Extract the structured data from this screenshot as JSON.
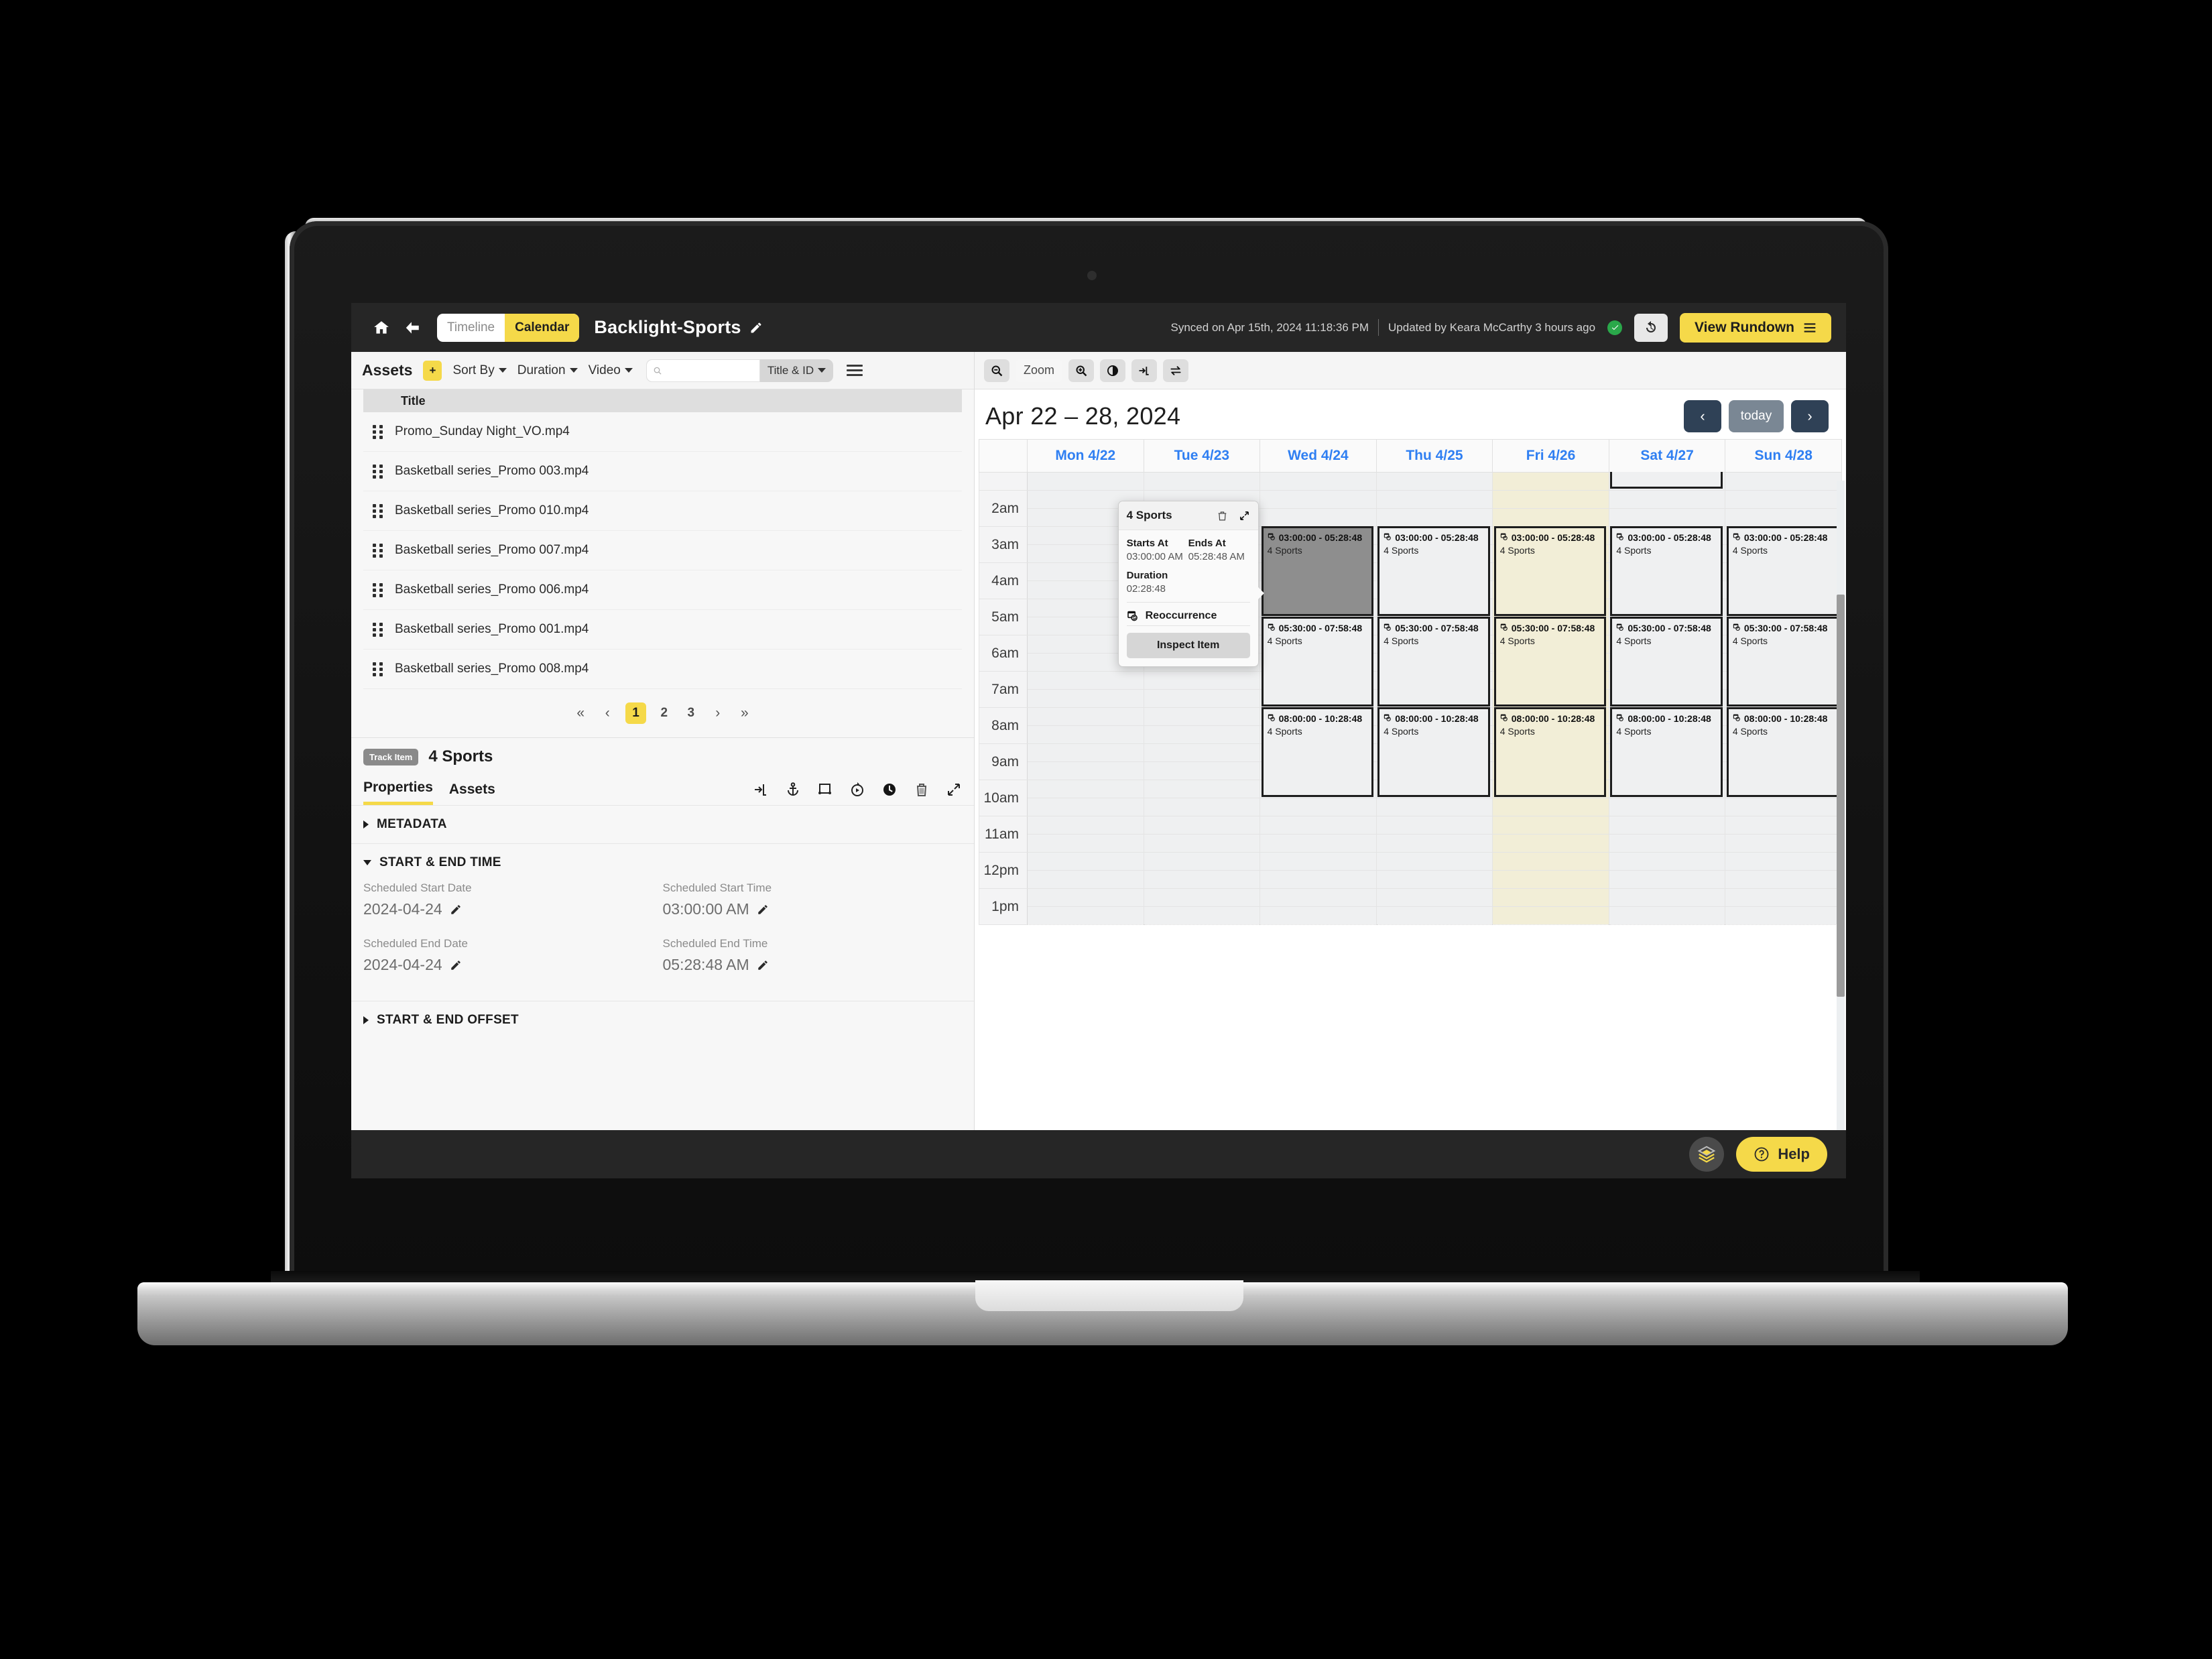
{
  "header": {
    "home_icon": "home-icon",
    "back_icon": "back-arrow-icon",
    "view_toggle": [
      {
        "label": "Timeline",
        "active": false
      },
      {
        "label": "Calendar",
        "active": true
      }
    ],
    "project_title": "Backlight-Sports",
    "edit_icon": "pencil-icon",
    "synced_text": "Synced on Apr 15th, 2024 11:18:36 PM",
    "updated_text": "Updated by Keara McCarthy 3 hours ago",
    "status_icon": "check-circle-icon",
    "status_color": "#2aa84a",
    "history_icon": "history-clock-icon",
    "rundown_label": "View Rundown",
    "rundown_icon": "list-menu-icon",
    "accent_color": "#f5d949"
  },
  "assets_toolbar": {
    "title": "Assets",
    "add_label": "+",
    "sort_by": "Sort By",
    "duration": "Duration",
    "media_type": "Video",
    "search_value": "",
    "search_placeholder": "",
    "search_scope": "Title & ID",
    "list_icon": "hamburger-icon",
    "zoom_out_icon": "zoom-out-icon",
    "zoom_label": "Zoom",
    "zoom_in_icon": "zoom-in-icon",
    "contrast_icon": "contrast-icon",
    "insert_icon": "insert-into-icon",
    "swap_icon": "swap-arrows-icon"
  },
  "asset_list": {
    "column_header": "Title",
    "rows": [
      {
        "title": "Promo_Sunday Night_VO.mp4"
      },
      {
        "title": "Basketball series_Promo 003.mp4"
      },
      {
        "title": "Basketball series_Promo 010.mp4"
      },
      {
        "title": "Basketball series_Promo 007.mp4"
      },
      {
        "title": "Basketball series_Promo 006.mp4"
      },
      {
        "title": "Basketball series_Promo 001.mp4"
      },
      {
        "title": "Basketball series_Promo 008.mp4"
      }
    ]
  },
  "pagination": {
    "first": "«",
    "prev": "‹",
    "pages": [
      "1",
      "2",
      "3"
    ],
    "current": "1",
    "next": "›",
    "last": "»"
  },
  "track_item": {
    "badge": "Track Item",
    "name": "4 Sports",
    "tabs": [
      {
        "label": "Properties",
        "active": true
      },
      {
        "label": "Assets",
        "active": false
      }
    ],
    "icons": [
      "insert-into-icon",
      "anchor-icon",
      "crop-frame-icon",
      "replay-icon",
      "clock-icon",
      "trash-icon",
      "collapse-icon"
    ],
    "sections": [
      {
        "label": "METADATA",
        "open": false
      },
      {
        "label": "START & END TIME",
        "open": true
      },
      {
        "label": "START & END OFFSET",
        "open": false
      }
    ],
    "fields": [
      {
        "label": "Scheduled Start Date",
        "value": "2024-04-24",
        "edit_icon": "pencil-icon"
      },
      {
        "label": "Scheduled Start Time",
        "value": "03:00:00 AM",
        "edit_icon": "pencil-icon"
      },
      {
        "label": "Scheduled End Date",
        "value": "2024-04-24",
        "edit_icon": "pencil-icon"
      },
      {
        "label": "Scheduled End Time",
        "value": "05:28:48 AM",
        "edit_icon": "pencil-icon"
      }
    ]
  },
  "calendar": {
    "title": "Apr 22 – 28, 2024",
    "prev_label": "‹",
    "today_label": "today",
    "next_label": "›",
    "day_headers": [
      "Mon 4/22",
      "Tue 4/23",
      "Wed 4/24",
      "Thu 4/25",
      "Fri 4/26",
      "Sat 4/27",
      "Sun 4/28"
    ],
    "highlight_day": "Fri 4/26",
    "highlight_color": "#f2eed7",
    "time_labels": [
      "2am",
      "3am",
      "4am",
      "5am",
      "6am",
      "7am",
      "8am",
      "9am",
      "10am",
      "11am",
      "12pm",
      "1pm"
    ],
    "events": [
      {
        "day": "Wed 4/24",
        "time": "03:00:00 - 05:28:48",
        "name": "4 Sports",
        "selected": true
      },
      {
        "day": "Thu 4/25",
        "time": "03:00:00 - 05:28:48",
        "name": "4 Sports",
        "selected": false
      },
      {
        "day": "Fri 4/26",
        "time": "03:00:00 - 05:28:48",
        "name": "4 Sports",
        "selected": false
      },
      {
        "day": "Sat 4/27",
        "time": "03:00:00 - 05:28:48",
        "name": "4 Sports",
        "selected": false
      },
      {
        "day": "Sun 4/28",
        "time": "03:00:00 - 05:28:48",
        "name": "4 Sports",
        "selected": false
      },
      {
        "day": "Wed 4/24",
        "time": "05:30:00 - 07:58:48",
        "name": "4 Sports",
        "selected": false
      },
      {
        "day": "Thu 4/25",
        "time": "05:30:00 - 07:58:48",
        "name": "4 Sports",
        "selected": false
      },
      {
        "day": "Fri 4/26",
        "time": "05:30:00 - 07:58:48",
        "name": "4 Sports",
        "selected": false
      },
      {
        "day": "Sat 4/27",
        "time": "05:30:00 - 07:58:48",
        "name": "4 Sports",
        "selected": false
      },
      {
        "day": "Sun 4/28",
        "time": "05:30:00 - 07:58:48",
        "name": "4 Sports",
        "selected": false
      },
      {
        "day": "Wed 4/24",
        "time": "08:00:00 - 10:28:48",
        "name": "4 Sports",
        "selected": false
      },
      {
        "day": "Thu 4/25",
        "time": "08:00:00 - 10:28:48",
        "name": "4 Sports",
        "selected": false
      },
      {
        "day": "Fri 4/26",
        "time": "08:00:00 - 10:28:48",
        "name": "4 Sports",
        "selected": false
      },
      {
        "day": "Sat 4/27",
        "time": "08:00:00 - 10:28:48",
        "name": "4 Sports",
        "selected": false
      },
      {
        "day": "Sun 4/28",
        "time": "08:00:00 - 10:28:48",
        "name": "4 Sports",
        "selected": false
      }
    ]
  },
  "popover": {
    "title": "4 Sports",
    "delete_icon": "trash-icon",
    "collapse_icon": "collapse-icon",
    "starts_at_label": "Starts At",
    "starts_at_value": "03:00:00 AM",
    "ends_at_label": "Ends At",
    "ends_at_value": "05:28:48 AM",
    "duration_label": "Duration",
    "duration_value": "02:28:48",
    "reoccurrence_label": "Reoccurrence",
    "reoccurrence_icon": "calendar-repeat-icon",
    "inspect_label": "Inspect Item"
  },
  "footer": {
    "stack_icon": "layers-icon",
    "help_label": "Help",
    "help_icon": "question-circle-icon"
  }
}
